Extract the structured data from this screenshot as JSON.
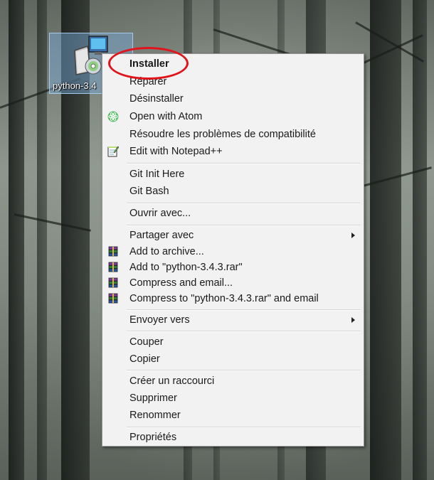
{
  "desktop": {
    "icon": {
      "label": "python-3.4",
      "icon_name": "installer-package-icon"
    }
  },
  "context_menu": {
    "groups": [
      [
        {
          "label": "Installer",
          "bold": true,
          "icon": null
        },
        {
          "label": "Réparer",
          "icon": null
        },
        {
          "label": "Désinstaller",
          "icon": null
        },
        {
          "label": "Open with Atom",
          "icon": "atom-icon"
        },
        {
          "label": "Résoudre les problèmes de compatibilité",
          "icon": null
        },
        {
          "label": "Edit with Notepad++",
          "icon": "notepad-plus-plus-icon"
        }
      ],
      [
        {
          "label": "Git Init Here",
          "icon": null
        },
        {
          "label": "Git Bash",
          "icon": null
        }
      ],
      [
        {
          "label": "Ouvrir avec...",
          "icon": null
        }
      ],
      [
        {
          "label": "Partager avec",
          "icon": null,
          "submenu": true
        },
        {
          "label": "Add to archive...",
          "icon": "winrar-icon"
        },
        {
          "label": "Add to \"python-3.4.3.rar\"",
          "icon": "winrar-icon"
        },
        {
          "label": "Compress and email...",
          "icon": "winrar-icon"
        },
        {
          "label": "Compress to \"python-3.4.3.rar\" and email",
          "icon": "winrar-icon"
        }
      ],
      [
        {
          "label": "Envoyer vers",
          "icon": null,
          "submenu": true
        }
      ],
      [
        {
          "label": "Couper",
          "icon": null
        },
        {
          "label": "Copier",
          "icon": null
        }
      ],
      [
        {
          "label": "Créer un raccourci",
          "icon": null
        },
        {
          "label": "Supprimer",
          "icon": null
        },
        {
          "label": "Renommer",
          "icon": null
        }
      ],
      [
        {
          "label": "Propriétés",
          "icon": null
        }
      ]
    ]
  },
  "annotation": {
    "color": "#e1141b",
    "target": "Installer"
  },
  "colors": {
    "menu_bg": "#f2f2f2",
    "menu_border": "#979797"
  }
}
